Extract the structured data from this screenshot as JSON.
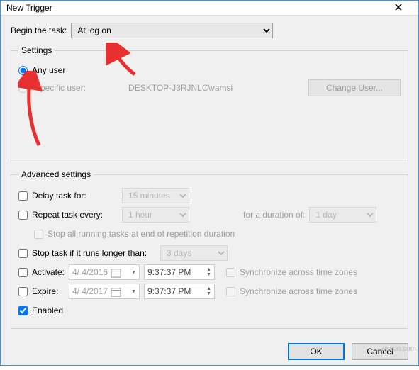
{
  "window": {
    "title": "New Trigger"
  },
  "begin": {
    "label": "Begin the task:",
    "value": "At log on"
  },
  "settings": {
    "legend": "Settings",
    "any_user_label": "Any user",
    "specific_user_label": "Specific user:",
    "specific_user_value": "DESKTOP-J3RJNLC\\vamsi",
    "change_user_label": "Change User..."
  },
  "advanced": {
    "legend": "Advanced settings",
    "delay_label": "Delay task for:",
    "delay_value": "15 minutes",
    "repeat_label": "Repeat task every:",
    "repeat_value": "1 hour",
    "duration_label": "for a duration of:",
    "duration_value": "1 day",
    "stop_all_label": "Stop all running tasks at end of repetition duration",
    "stop_if_label": "Stop task if it runs longer than:",
    "stop_if_value": "3 days",
    "activate_label": "Activate:",
    "activate_date": "4/ 4/2016",
    "activate_time": "9:37:37 PM",
    "sync_label": "Synchronize across time zones",
    "expire_label": "Expire:",
    "expire_date": "4/ 4/2017",
    "expire_time": "9:37:37 PM",
    "enabled_label": "Enabled"
  },
  "buttons": {
    "ok": "OK",
    "cancel": "Cancel"
  },
  "watermark": "wsxdn.com"
}
